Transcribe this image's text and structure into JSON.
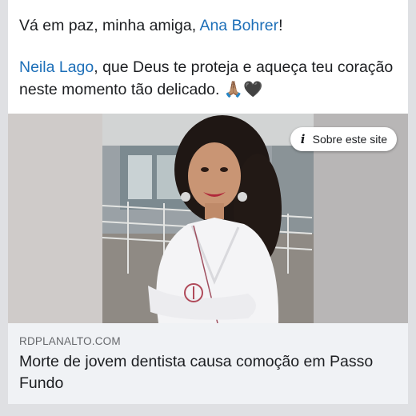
{
  "post": {
    "line1_before": "Vá em paz, minha amiga, ",
    "line1_mention": "Ana Bohrer",
    "line1_after": "!",
    "line2_mention": "Neila Lago",
    "line2_after": ", que Deus te proteja e aqueça teu coração neste momento tão delicado. 🙏🏽🖤"
  },
  "link_preview": {
    "about_label": "Sobre este site",
    "domain": "RDPLANALTO.COM",
    "headline": "Morte de jovem dentista causa comoção em Passo Fundo"
  },
  "colors": {
    "mention": "#1d6fb8",
    "text": "#1c1e21",
    "muted": "#65676b",
    "card_bg": "#f0f2f5"
  }
}
